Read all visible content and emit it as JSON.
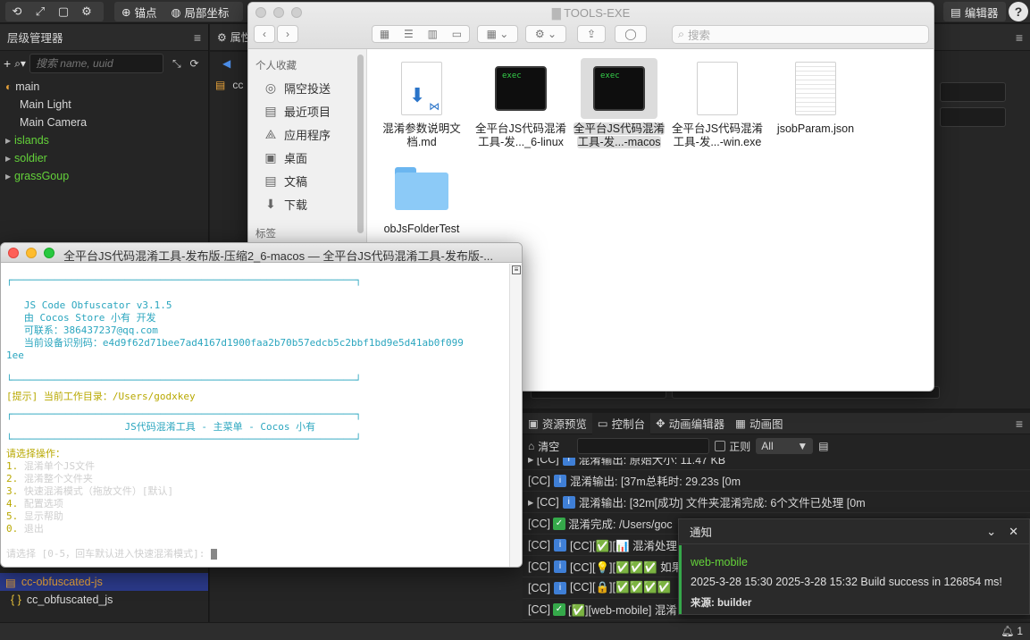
{
  "toolbar": {
    "anchor_label": "锚点",
    "local_coord_label": "局部坐标",
    "editor_label": "编辑器",
    "help_label": "?"
  },
  "hierarchy": {
    "title": "层级管理器",
    "search_placeholder": "搜索 name, uuid",
    "items": [
      {
        "label": "main"
      },
      {
        "label": "Main Light"
      },
      {
        "label": "Main Camera"
      },
      {
        "label": "islands"
      },
      {
        "label": "soldier"
      },
      {
        "label": "grassGoup"
      }
    ],
    "bottom_items": [
      {
        "label": "cc-obfuscated-js"
      },
      {
        "label": "cc_obfuscated_js"
      }
    ]
  },
  "inspector": {
    "title": "属性",
    "partial_label": "cc"
  },
  "finder": {
    "title": "TOOLS-EXE",
    "search_placeholder": "搜索",
    "sidebar_section": "个人收藏",
    "sidebar_items": [
      {
        "label": "隔空投送",
        "icon": "airdrop-icon"
      },
      {
        "label": "最近项目",
        "icon": "recent-icon"
      },
      {
        "label": "应用程序",
        "icon": "applications-icon"
      },
      {
        "label": "桌面",
        "icon": "desktop-icon"
      },
      {
        "label": "文稿",
        "icon": "documents-icon"
      },
      {
        "label": "下载",
        "icon": "downloads-icon"
      }
    ],
    "tags_section": "标签",
    "files": [
      {
        "line1": "混淆参数说明文",
        "line2": "档.md"
      },
      {
        "line1": "全平台JS代码混淆",
        "line2": "工具-发..._6-linux",
        "badge": "exec"
      },
      {
        "line1": "全平台JS代码混淆",
        "line2": "工具-发...-macos",
        "badge": "exec"
      },
      {
        "line1": "全平台JS代码混淆",
        "line2": "工具-发...-win.exe"
      },
      {
        "line1": "jsobParam.json",
        "line2": ""
      },
      {
        "line1": "obJsFolderTest",
        "line2": ""
      }
    ]
  },
  "terminal": {
    "title": "全平台JS代码混淆工具-发布版-压缩2_6-macos — 全平台JS代码混淆工具-发布版-...",
    "box_top": "┌──────────────────────────────────────────────────────────┐",
    "box_bottom": "└──────────────────────────────────────────────────────────┘",
    "version": "JS Code Obfuscator v3.1.5",
    "author": "由 Cocos Store 小有 开发",
    "contact": "可联系：386437237@qq.com",
    "device_id": "当前设备识别码：e4d9f62d71bee7ad4167d1900faa2b70b57edcb5c2bbf1bd9e5d41ab0f099",
    "device_id_tail": "1ee",
    "hint": "[提示] 当前工作目录：/Users/godxkey",
    "menu_box_top": "┌──────────────────────────────────────────────────────────┐",
    "menu_title": "JS代码混淆工具 - 主菜单 - Cocos 小有",
    "menu_box_bottom": "└──────────────────────────────────────────────────────────┘",
    "prompt_choose": "请选择操作：",
    "options": [
      {
        "num": "1.",
        "text": "混淆单个JS文件"
      },
      {
        "num": "2.",
        "text": "混淆整个文件夹"
      },
      {
        "num": "3.",
        "text": "快速混淆模式（拖放文件）[默认]"
      },
      {
        "num": "4.",
        "text": "配置选项"
      },
      {
        "num": "5.",
        "text": "显示帮助"
      },
      {
        "num": "0.",
        "text": "退出"
      }
    ],
    "input_prompt": "请选择 [0-5，回车默认进入快速混淆模式]: "
  },
  "console": {
    "tabs": [
      {
        "label": "资源预览"
      },
      {
        "label": "控制台"
      },
      {
        "label": "动画编辑器"
      },
      {
        "label": "动画图"
      }
    ],
    "clear_label": "清空",
    "regex_label": "正则",
    "filter_value": "All",
    "logs": [
      {
        "prefix": "▸ [CC]",
        "text": "混淆输出: 原始大小: 11.47 KB"
      },
      {
        "prefix": "[CC]",
        "text": "混淆输出:  [37m总耗时: 29.23s [0m"
      },
      {
        "prefix": "▸ [CC]",
        "text": "混淆输出:  [32m[成功] 文件夹混淆完成: 6个文件已处理 [0m"
      },
      {
        "prefix": "[CC]",
        "text": "混淆完成: /Users/goc"
      },
      {
        "prefix": "[CC]",
        "text": "[CC][✅][📊 混淆处理"
      },
      {
        "prefix": "[CC]",
        "text": "[CC][💡][✅✅✅ 如果"
      },
      {
        "prefix": "[CC]",
        "text": "[CC][🔒][✅✅✅✅"
      },
      {
        "prefix": "[CC]",
        "text": "[✅][web-mobile] 混淆"
      }
    ]
  },
  "notification": {
    "title": "通知",
    "app": "web-mobile",
    "message": "2025-3-28 15:30 2025-3-28 15:32 Build success in 126854 ms!",
    "source": "来源: builder"
  },
  "statusbar": {
    "count": "1"
  },
  "colors": {
    "accent_green": "#64d23a",
    "selection_blue": "#2b3a8a",
    "terminal_cyan": "#2ba6bf",
    "terminal_yellow": "#b8a800"
  }
}
